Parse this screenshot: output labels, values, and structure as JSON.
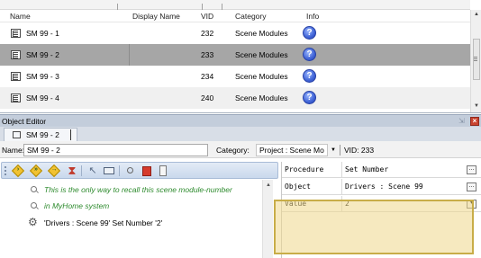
{
  "list": {
    "columns": [
      "Name",
      "Display Name",
      "VID",
      "Category",
      "Info"
    ],
    "rows": [
      {
        "name": "SM 99 - 1",
        "display_name": "",
        "vid": "232",
        "category": "Scene Modules",
        "info": "?",
        "selected": false
      },
      {
        "name": "SM 99 - 2",
        "display_name": "",
        "vid": "233",
        "category": "Scene Modules",
        "info": "?",
        "selected": true
      },
      {
        "name": "SM 99 - 3",
        "display_name": "",
        "vid": "234",
        "category": "Scene Modules",
        "info": "?",
        "selected": false
      },
      {
        "name": "SM 99 - 4",
        "display_name": "",
        "vid": "240",
        "category": "Scene Modules",
        "info": "?",
        "selected": false
      }
    ]
  },
  "editor": {
    "title": "Object Editor",
    "tab_label": "SM 99 - 2",
    "name_label": "Name:",
    "name_value": "SM 99 - 2",
    "category_label": "Category:",
    "category_value": "Project : Scene Mo",
    "vid_text": "VID: 233"
  },
  "code": {
    "lines": [
      {
        "kind": "comment",
        "text": "This is the only way to recall this scene module-number"
      },
      {
        "kind": "comment",
        "text": "in MyHome system"
      },
      {
        "kind": "action",
        "text": "'Drivers : Scene 99' Set Number '2'"
      }
    ]
  },
  "properties": [
    {
      "key": "Procedure",
      "value": "Set Number"
    },
    {
      "key": "Object",
      "value": "Drivers : Scene 99"
    },
    {
      "key": "Value",
      "value": "2"
    }
  ],
  "colors": {
    "selected_row": "#a6a6a6",
    "alt_row": "#f0f0f0",
    "panel_title": "#c3cddb",
    "comment_text": "#2e8b2e",
    "highlight": "#efd78b"
  }
}
